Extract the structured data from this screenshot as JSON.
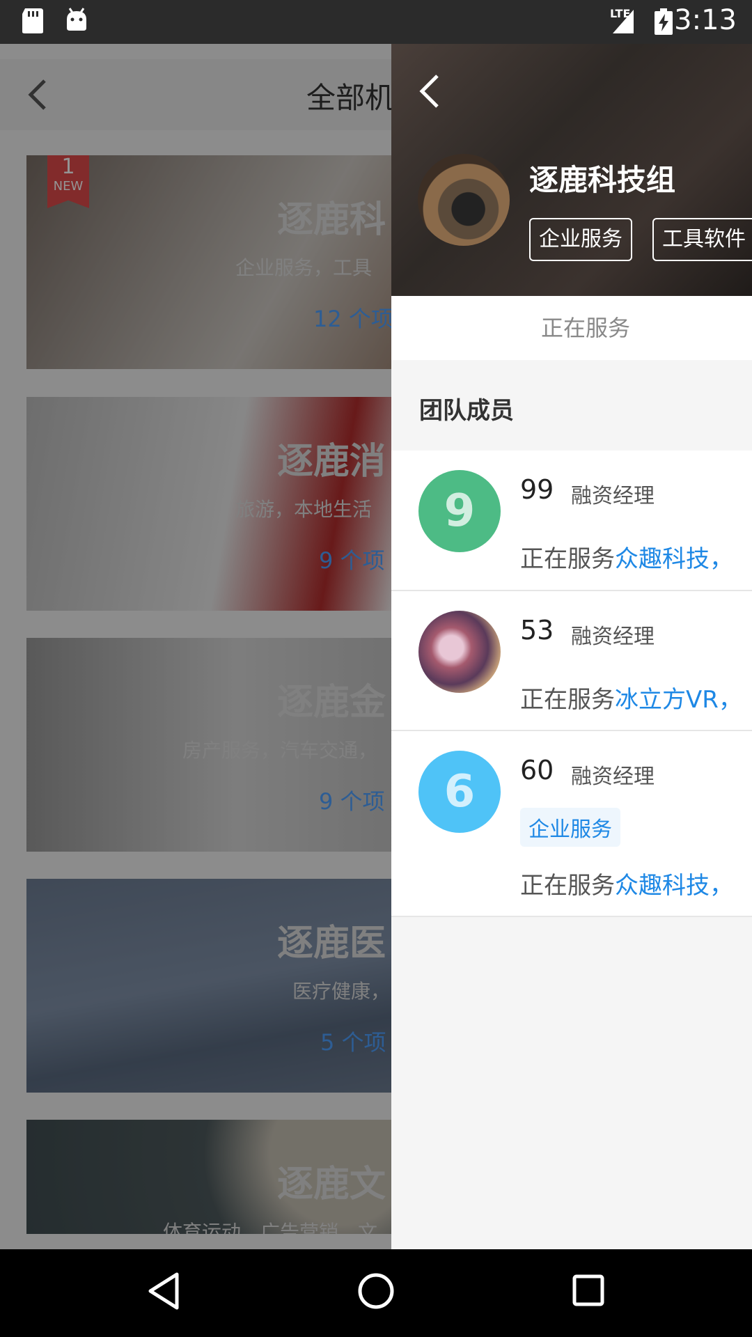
{
  "status_bar": {
    "time": "3:13",
    "network": "LTE"
  },
  "background": {
    "title": "全部机",
    "cards": [
      {
        "title": "逐鹿科",
        "subtitle": "企业服务，工具",
        "count": "12 个项",
        "badge_num": "1",
        "badge_text": "NEW"
      },
      {
        "title": "逐鹿消",
        "subtitle": "旅游，本地生活",
        "count": "9 个项"
      },
      {
        "title": "逐鹿金",
        "subtitle": "房产服务，汽车交通，",
        "count": "9 个项"
      },
      {
        "title": "逐鹿医",
        "subtitle": "医疗健康，",
        "count": "5 个项"
      },
      {
        "title": "逐鹿文",
        "subtitle": "体育运动，广告营销，文",
        "count": ""
      }
    ]
  },
  "drawer": {
    "group_name": "逐鹿科技组",
    "tags": [
      "企业服务",
      "工具软件"
    ],
    "status": "正在服务",
    "section_title": "团队成员",
    "members": [
      {
        "avatar_text": "9",
        "avatar_color": "#4dbb85",
        "number": "99",
        "role": "融资经理",
        "serving_prefix": "正在服务",
        "serving_company": "众趣科技，",
        "tag": ""
      },
      {
        "avatar_text": "",
        "avatar_color": "#7a5a6a",
        "number": "53",
        "role": "融资经理",
        "serving_prefix": "正在服务",
        "serving_company": "冰立方VR，",
        "tag": ""
      },
      {
        "avatar_text": "6",
        "avatar_color": "#4fc3f7",
        "number": "60",
        "role": "融资经理",
        "serving_prefix": "正在服务",
        "serving_company": "众趣科技，",
        "tag": "企业服务"
      }
    ]
  },
  "colors": {
    "accent": "#1e88e5",
    "badge": "#e04a4a"
  }
}
